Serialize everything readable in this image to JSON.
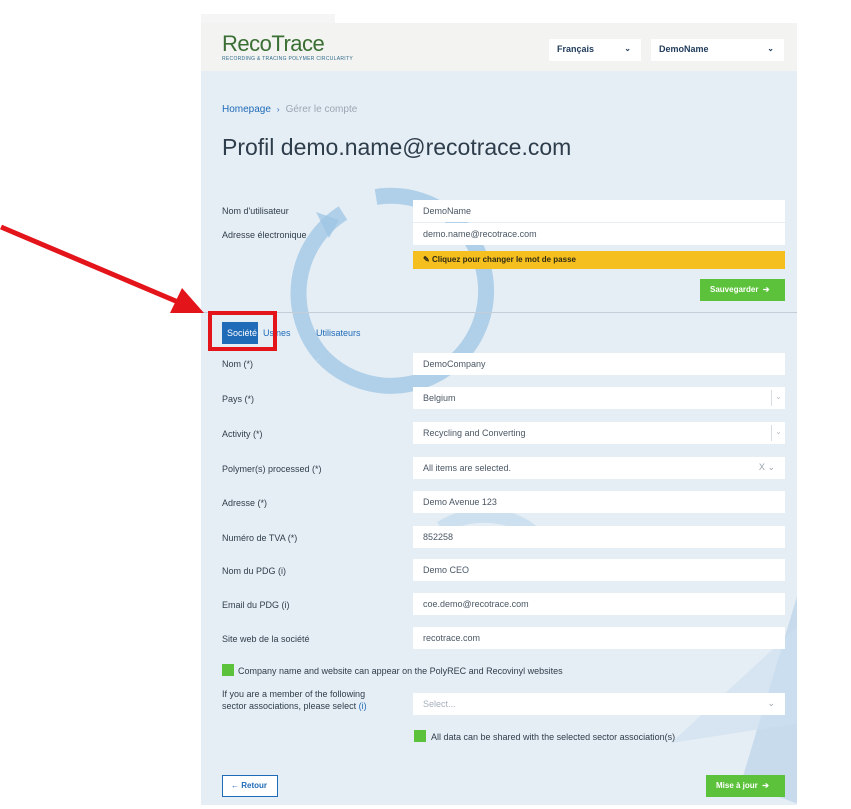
{
  "header": {
    "logo_text": "RecoTrace",
    "logo_tagline": "RECORDING & TRACING POLYMER CIRCULARITY",
    "language": "Français",
    "user": "DemoName"
  },
  "breadcrumb": {
    "home": "Homepage",
    "current": "Gérer le compte"
  },
  "page_title": "Profil demo.name@recotrace.com",
  "account": {
    "username_label": "Nom d'utilisateur",
    "username_value": "DemoName",
    "email_label": "Adresse électronique",
    "email_value": "demo.name@recotrace.com",
    "change_password_label": "Cliquez pour changer le mot de passe",
    "save_label": "Sauvegarder"
  },
  "tabs": [
    {
      "label": "Société",
      "active": true
    },
    {
      "label": "Usines",
      "active": false
    },
    {
      "label": "Utilisateurs",
      "active": false
    }
  ],
  "company": {
    "name_label": "Nom (*)",
    "name_value": "DemoCompany",
    "country_label": "Pays (*)",
    "country_value": "Belgium",
    "activity_label": "Activity (*)",
    "activity_value": "Recycling and Converting",
    "polymers_label": "Polymer(s) processed (*)",
    "polymers_value": "All items are selected.",
    "polymers_clear": "X",
    "address_label": "Adresse (*)",
    "address_value": "Demo Avenue 123",
    "vat_label": "Numéro de TVA (*)",
    "vat_value": "852258",
    "ceo_label": "Nom du PDG (i)",
    "ceo_value": "Demo CEO",
    "ceo_email_label": "Email du PDG (i)",
    "ceo_email_value": "coe.demo@recotrace.com",
    "website_label": "Site web de la société",
    "website_value": "recotrace.com",
    "publish_checkbox_label": "Company name and website can appear on the PolyREC and Recovinyl websites",
    "associations_label_1": "If you are a member of the following",
    "associations_label_2": "sector associations, please select",
    "associations_info": "(i)",
    "associations_placeholder": "Select...",
    "share_checkbox_label": "All data can be shared with the selected sector association(s)"
  },
  "footer": {
    "back_label": "Retour",
    "update_label": "Mise à jour"
  },
  "colors": {
    "primary_blue": "#1f6bb8",
    "green": "#5cc23b",
    "yellow": "#f5bf1f",
    "annotation_red": "#e4141b",
    "background": "#e6eef5"
  }
}
